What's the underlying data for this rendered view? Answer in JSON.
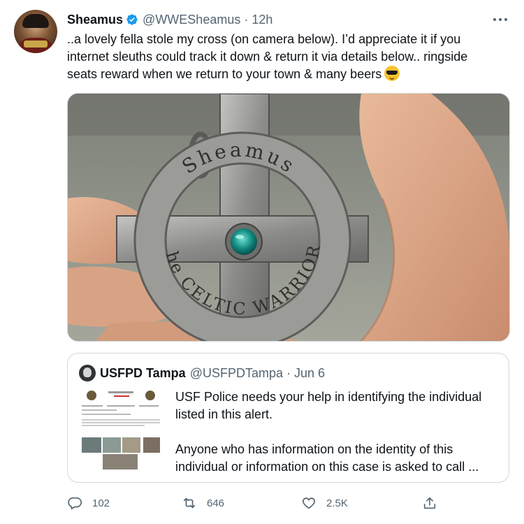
{
  "tweet": {
    "author_name": "Sheamus",
    "handle": "@WWESheamus",
    "separator": "·",
    "time": "12h",
    "text": "..a lovely fella stole my cross (on camera below). I’d appreciate it if you internet sleuths could track it down & return it via details below.. ringside seats reward when we return to your town & many beers",
    "emoji": "smiling-face-with-sunglasses",
    "media_text": {
      "ring_top": "Sheamus",
      "ring_bottom": "the CELTIC WARRIOR"
    }
  },
  "quoted_tweet": {
    "author_name": "USFPD Tampa",
    "handle": "@USFPDTampa",
    "separator": "·",
    "date": "Jun 6",
    "paragraph_1": "USF Police needs your help in identifying the individual listed in this alert.",
    "paragraph_2": "Anyone who has information on the identity of this individual or information on this case is asked to call ..."
  },
  "actions": {
    "reply_count": "102",
    "retweet_count": "646",
    "like_count": "2.5K"
  },
  "colors": {
    "text_primary": "#0f1419",
    "text_secondary": "#536471",
    "verified_blue": "#1d9bf0",
    "border": "#cfd9de"
  },
  "icons": [
    "more-icon",
    "verified-badge-icon",
    "reply-icon",
    "retweet-icon",
    "like-icon",
    "share-icon"
  ]
}
